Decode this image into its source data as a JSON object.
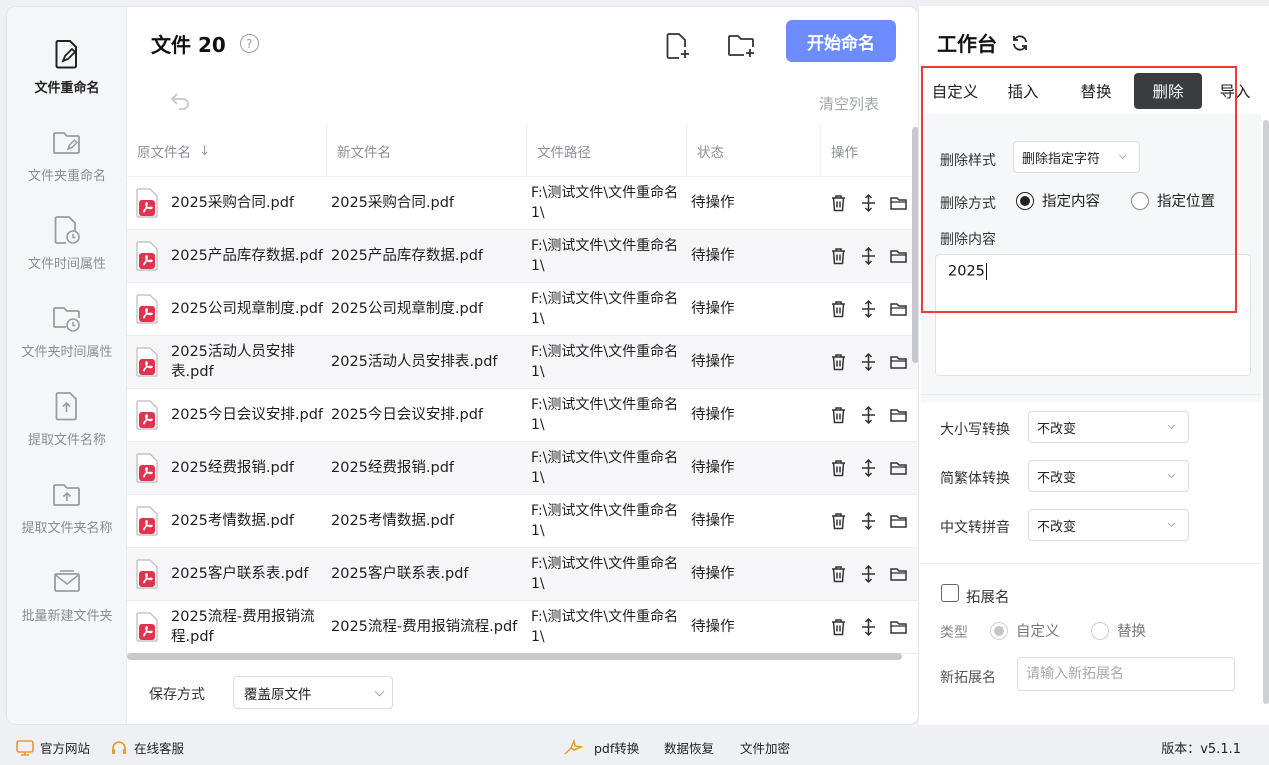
{
  "sidebar": {
    "items": [
      {
        "label": "文件重命名",
        "icon": "file-edit-icon",
        "active": true
      },
      {
        "label": "文件夹重命名",
        "icon": "folder-edit-icon"
      },
      {
        "label": "文件时间属性",
        "icon": "file-clock-icon"
      },
      {
        "label": "文件夹时间属性",
        "icon": "folder-clock-icon"
      },
      {
        "label": "提取文件名称",
        "icon": "file-upload-icon"
      },
      {
        "label": "提取文件夹名称",
        "icon": "folder-upload-icon"
      },
      {
        "label": "批量新建文件夹",
        "icon": "mail-folder-icon"
      }
    ]
  },
  "header": {
    "title": "文件 20",
    "help": "?",
    "start_label": "开始命名",
    "clear_label": "清空列表"
  },
  "table": {
    "columns": [
      "原文件名",
      "新文件名",
      "文件路径",
      "状态",
      "操作"
    ],
    "rows": [
      {
        "orig": "2025采购合同.pdf",
        "new": "2025采购合同.pdf",
        "path": "F:\\测试文件\\文件重命名1\\",
        "status": "待操作"
      },
      {
        "orig": "2025产品库存数据.pdf",
        "new": "2025产品库存数据.pdf",
        "path": "F:\\测试文件\\文件重命名1\\",
        "status": "待操作"
      },
      {
        "orig": "2025公司规章制度.pdf",
        "new": "2025公司规章制度.pdf",
        "path": "F:\\测试文件\\文件重命名1\\",
        "status": "待操作"
      },
      {
        "orig": "2025活动人员安排表.pdf",
        "new": "2025活动人员安排表.pdf",
        "path": "F:\\测试文件\\文件重命名1\\",
        "status": "待操作"
      },
      {
        "orig": "2025今日会议安排.pdf",
        "new": "2025今日会议安排.pdf",
        "path": "F:\\测试文件\\文件重命名1\\",
        "status": "待操作"
      },
      {
        "orig": "2025经费报销.pdf",
        "new": "2025经费报销.pdf",
        "path": "F:\\测试文件\\文件重命名1\\",
        "status": "待操作"
      },
      {
        "orig": "2025考情数据.pdf",
        "new": "2025考情数据.pdf",
        "path": "F:\\测试文件\\文件重命名1\\",
        "status": "待操作"
      },
      {
        "orig": "2025客户联系表.pdf",
        "new": "2025客户联系表.pdf",
        "path": "F:\\测试文件\\文件重命名1\\",
        "status": "待操作"
      },
      {
        "orig": "2025流程-费用报销流程.pdf",
        "new": "2025流程-费用报销流程.pdf",
        "path": "F:\\测试文件\\文件重命名1\\",
        "status": "待操作"
      }
    ]
  },
  "save": {
    "label": "保存方式",
    "value": "覆盖原文件"
  },
  "workbench": {
    "title": "工作台",
    "tabs": [
      "自定义",
      "插入",
      "替换",
      "删除",
      "导入"
    ],
    "active_tab": "删除",
    "delete_style_label": "删除样式",
    "delete_style_value": "删除指定字符",
    "delete_mode_label": "删除方式",
    "mode_content": "指定内容",
    "mode_position": "指定位置",
    "delete_content_label": "删除内容",
    "delete_content_value": "2025",
    "case_label": "大小写转换",
    "case_value": "不改变",
    "trad_label": "简繁体转换",
    "trad_value": "不改变",
    "pinyin_label": "中文转拼音",
    "pinyin_value": "不改变",
    "ext_label": "拓展名",
    "type_label": "类型",
    "type_custom": "自定义",
    "type_replace": "替换",
    "new_ext_label": "新拓展名",
    "new_ext_placeholder": "请输入新拓展名"
  },
  "footer": {
    "website": "官方网站",
    "service": "在线客服",
    "pdf": "pdf转换",
    "recovery": "数据恢复",
    "encrypt": "文件加密",
    "version": "版本：v5.1.1"
  },
  "colors": {
    "accent": "#6c8cff",
    "active_tab": "#3b3c40",
    "highlight": "#ec3b3b",
    "pdf_red": "#e0334f"
  }
}
